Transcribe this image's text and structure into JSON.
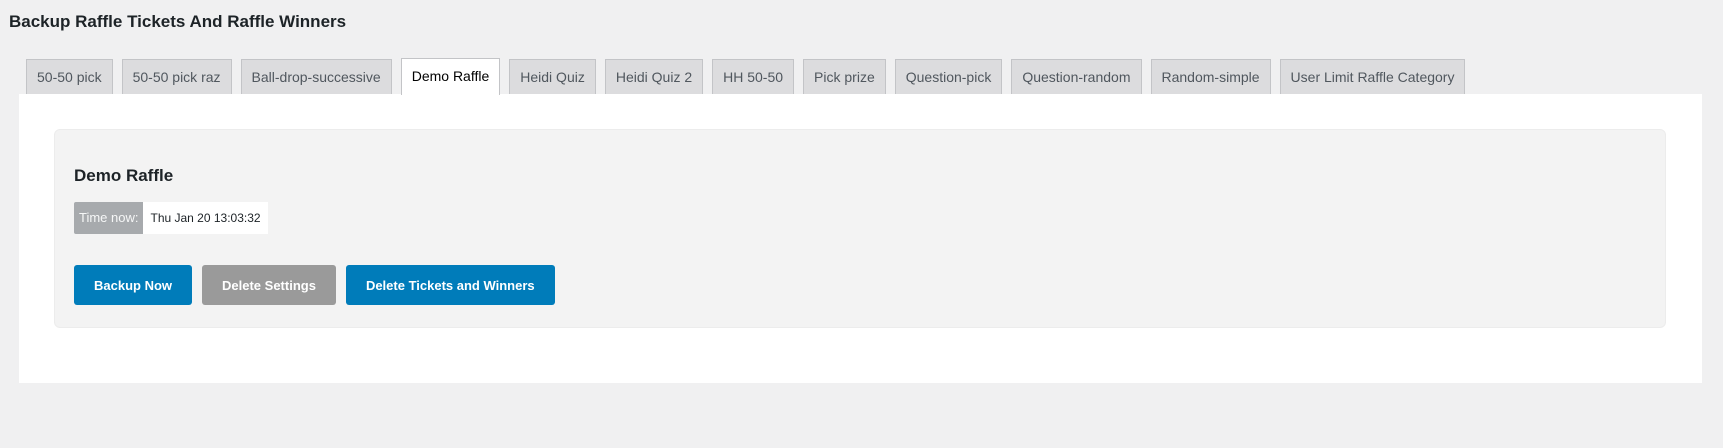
{
  "page": {
    "title": "Backup Raffle Tickets And Raffle Winners"
  },
  "tabs": [
    {
      "label": "50-50 pick",
      "active": false
    },
    {
      "label": "50-50 pick raz",
      "active": false
    },
    {
      "label": "Ball-drop-successive",
      "active": false
    },
    {
      "label": "Demo Raffle",
      "active": true
    },
    {
      "label": "Heidi Quiz",
      "active": false
    },
    {
      "label": "Heidi Quiz 2",
      "active": false
    },
    {
      "label": "HH 50-50",
      "active": false
    },
    {
      "label": "Pick prize",
      "active": false
    },
    {
      "label": "Question-pick",
      "active": false
    },
    {
      "label": "Question-random",
      "active": false
    },
    {
      "label": "Random-simple",
      "active": false
    },
    {
      "label": "User Limit Raffle Category",
      "active": false
    }
  ],
  "panel": {
    "raffle_title": "Demo Raffle",
    "time_label": "Time now:",
    "time_value": "Thu Jan 20 13:03:32",
    "buttons": {
      "backup": "Backup Now",
      "delete_settings": "Delete Settings",
      "delete_tickets": "Delete Tickets and Winners"
    }
  },
  "colors": {
    "primary_button": "#007cba",
    "secondary_button": "#9a9a9a",
    "page_background": "#f0f0f1"
  }
}
